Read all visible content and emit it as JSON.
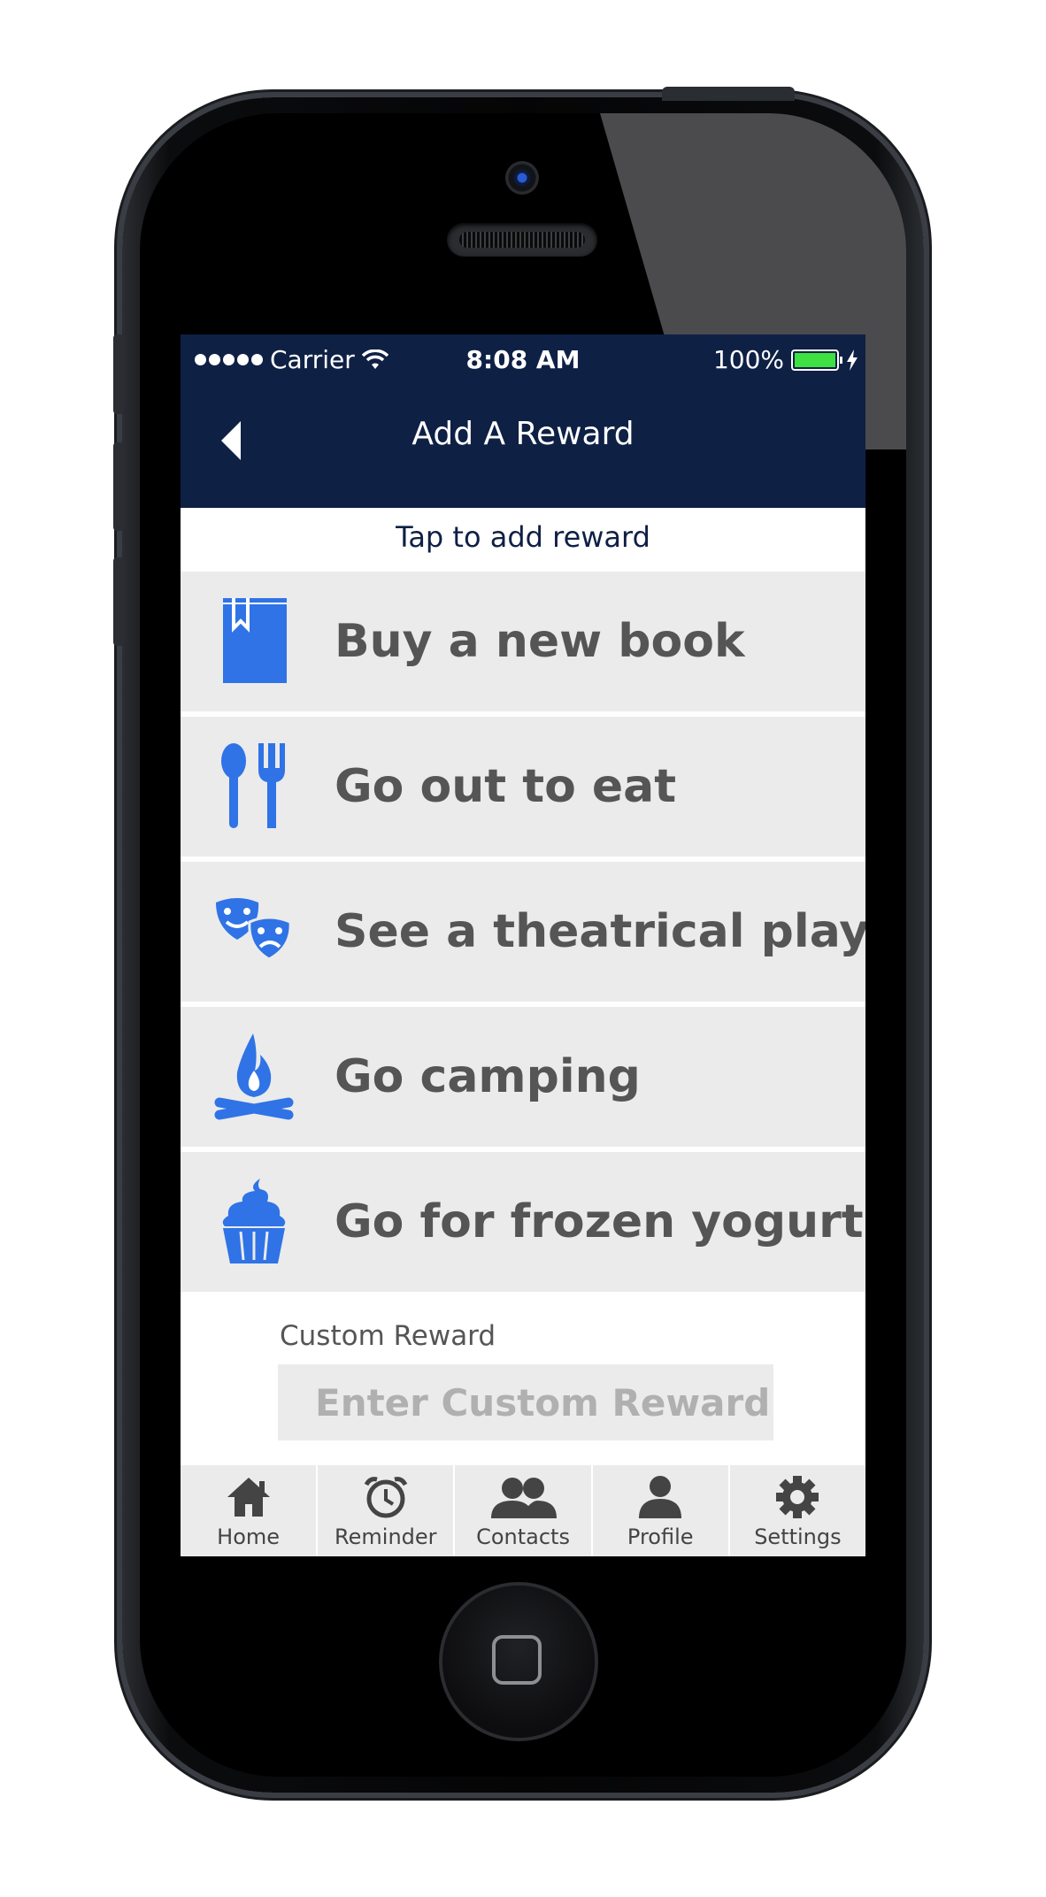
{
  "status_bar": {
    "carrier": "Carrier",
    "time": "8:08 AM",
    "battery": "100%"
  },
  "navbar": {
    "title": "Add A Reward"
  },
  "subtitle": "Tap to add reward",
  "rewards": [
    {
      "label": "Buy a new book",
      "icon": "book-icon"
    },
    {
      "label": "Go out to eat",
      "icon": "utensils-icon"
    },
    {
      "label": "See a theatrical play",
      "icon": "theater-masks-icon"
    },
    {
      "label": "Go camping",
      "icon": "campfire-icon"
    },
    {
      "label": "Go for frozen yogurt",
      "icon": "frozen-yogurt-icon"
    }
  ],
  "custom": {
    "label": "Custom Reward",
    "placeholder": "Enter Custom Reward"
  },
  "tabs": [
    {
      "label": "Home",
      "icon": "home-icon"
    },
    {
      "label": "Reminder",
      "icon": "alarm-clock-icon"
    },
    {
      "label": "Contacts",
      "icon": "contacts-icon"
    },
    {
      "label": "Profile",
      "icon": "profile-icon"
    },
    {
      "label": "Settings",
      "icon": "gear-icon"
    }
  ],
  "colors": {
    "navbar": "#0f2045",
    "accent": "#2f73e6",
    "item_bg": "#ebebeb",
    "item_text": "#555555"
  }
}
